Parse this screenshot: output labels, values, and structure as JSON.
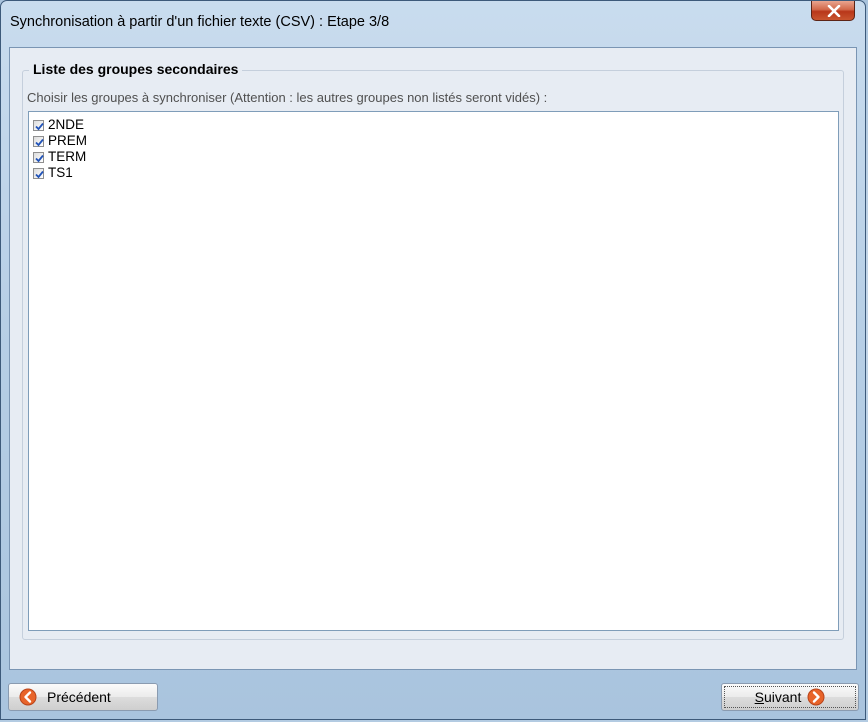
{
  "window": {
    "title": "Synchronisation à partir d'un fichier texte (CSV) : Etape 3/8",
    "close_icon": "close-icon"
  },
  "group": {
    "title": "Liste des groupes secondaires",
    "instruction": "Choisir les groupes à synchroniser  (Attention : les autres groupes non listés seront vidés) :",
    "items": [
      {
        "label": "2NDE",
        "checked": true
      },
      {
        "label": "PREM",
        "checked": true
      },
      {
        "label": "TERM",
        "checked": true
      },
      {
        "label": "TS1",
        "checked": true
      }
    ]
  },
  "buttons": {
    "previous_label": "Précédent",
    "previous_icon": "arrow-left-icon",
    "next_accel": "S",
    "next_rest": "uivant",
    "next_icon": "arrow-right-icon"
  },
  "colors": {
    "arrow_orange": "#e8642a",
    "checkmark_blue": "#2153b8"
  }
}
